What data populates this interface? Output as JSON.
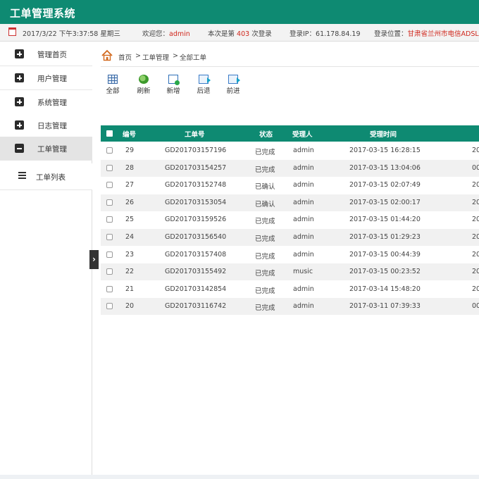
{
  "header": {
    "title": "工单管理系统"
  },
  "infobar": {
    "datetime": "2017/3/22 下午3:37:58 星期三",
    "welcome_prefix": "欢迎您：",
    "username": "admin",
    "login_prefix": "本次是第",
    "login_count": "403",
    "login_suffix": "次登录",
    "ip_label": "登录IP：61.178.84.19",
    "location_label": "登录位置：",
    "location_value": "甘肃省兰州市电信ADSL",
    "colors": {
      "accent": "#0e8a72",
      "highlight": "#d0271c"
    }
  },
  "sidebar": {
    "items": [
      {
        "label": "管理首页",
        "icon": "plus-icon"
      },
      {
        "label": "用户管理",
        "icon": "plus-icon"
      },
      {
        "label": "系统管理",
        "icon": "plus-icon"
      },
      {
        "label": "日志管理",
        "icon": "plus-icon"
      },
      {
        "label": "工单管理",
        "icon": "minus-icon"
      }
    ],
    "sub_items": [
      {
        "label": "工单列表",
        "icon": "list-icon"
      }
    ],
    "collapse_glyph": "›"
  },
  "breadcrumb": {
    "items": [
      "首页",
      "工单管理",
      "全部工单"
    ],
    "separator": ">"
  },
  "toolbar": {
    "buttons": [
      {
        "label": "全部",
        "icon": "grid-icon"
      },
      {
        "label": "刷新",
        "icon": "refresh-icon"
      },
      {
        "label": "新增",
        "icon": "add-icon"
      },
      {
        "label": "后退",
        "icon": "back-icon"
      },
      {
        "label": "前进",
        "icon": "forward-icon"
      }
    ]
  },
  "table": {
    "columns": [
      "编号",
      "工单号",
      "状态",
      "受理人",
      "受理时间"
    ],
    "rows": [
      {
        "id": "29",
        "ticket": "GD201703157196",
        "status": "已完成",
        "assignee": "admin",
        "time": "2017-03-15 16:28:15",
        "extra": "20"
      },
      {
        "id": "28",
        "ticket": "GD201703154257",
        "status": "已完成",
        "assignee": "admin",
        "time": "2017-03-15 13:04:06",
        "extra": "00"
      },
      {
        "id": "27",
        "ticket": "GD201703152748",
        "status": "已确认",
        "assignee": "admin",
        "time": "2017-03-15 02:07:49",
        "extra": "20"
      },
      {
        "id": "26",
        "ticket": "GD201703153054",
        "status": "已确认",
        "assignee": "admin",
        "time": "2017-03-15 02:00:17",
        "extra": "20"
      },
      {
        "id": "25",
        "ticket": "GD201703159526",
        "status": "已完成",
        "assignee": "admin",
        "time": "2017-03-15 01:44:20",
        "extra": "20"
      },
      {
        "id": "24",
        "ticket": "GD201703156540",
        "status": "已完成",
        "assignee": "admin",
        "time": "2017-03-15 01:29:23",
        "extra": "20"
      },
      {
        "id": "23",
        "ticket": "GD201703157408",
        "status": "已完成",
        "assignee": "admin",
        "time": "2017-03-15 00:44:39",
        "extra": "20"
      },
      {
        "id": "22",
        "ticket": "GD201703155492",
        "status": "已完成",
        "assignee": "music",
        "time": "2017-03-15 00:23:52",
        "extra": "20"
      },
      {
        "id": "21",
        "ticket": "GD201703142854",
        "status": "已完成",
        "assignee": "admin",
        "time": "2017-03-14 15:48:20",
        "extra": "20"
      },
      {
        "id": "20",
        "ticket": "GD201703116742",
        "status": "已完成",
        "assignee": "admin",
        "time": "2017-03-11 07:39:33",
        "extra": "00"
      }
    ]
  }
}
